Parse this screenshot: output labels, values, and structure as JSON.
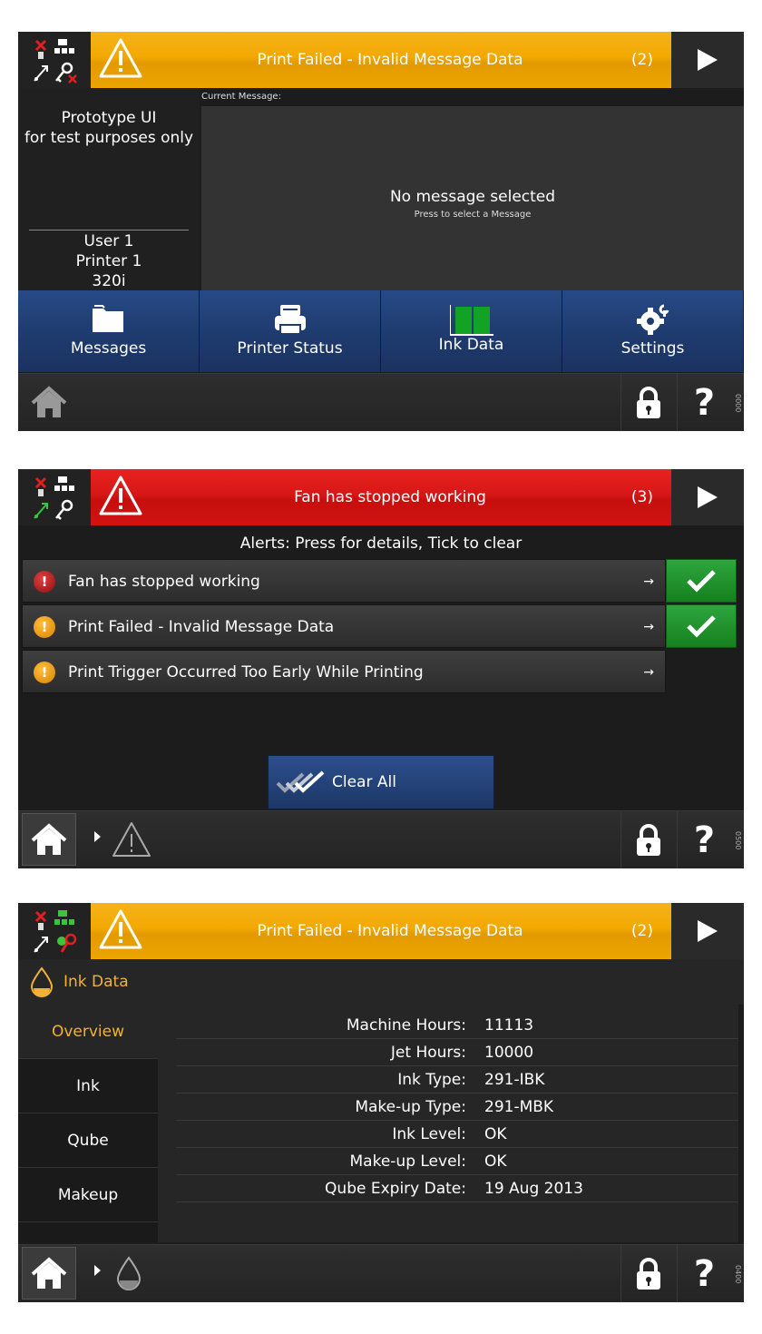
{
  "colors": {
    "amber": "#f2a900",
    "red": "#d71716",
    "nav_blue": "#1f3c70",
    "accent_orange": "#f2b233",
    "green": "#1f9a2e"
  },
  "screen1": {
    "banner": {
      "text": "Print Failed - Invalid Message Data",
      "count": "(2)"
    },
    "left_panel": {
      "line1": "Prototype UI",
      "line2": "for test purposes only",
      "user": "User 1",
      "printer": "Printer 1",
      "model": "320i"
    },
    "current_message_label": "Current Message:",
    "no_message": "No message selected",
    "no_message_hint": "Press to select a Message",
    "nav": [
      {
        "label": "Messages",
        "icon": "folder-icon"
      },
      {
        "label": "Printer Status",
        "icon": "printer-icon"
      },
      {
        "label": "Ink Data",
        "icon": "ink-level-icon"
      },
      {
        "label": "Settings",
        "icon": "settings-gear-icon"
      }
    ],
    "screen_code": "0000"
  },
  "screen2": {
    "banner": {
      "text": "Fan has stopped working",
      "count": "(3)"
    },
    "header": "Alerts: Press for details, Tick to clear",
    "alerts": [
      {
        "text": "Fan has stopped working",
        "severity": "error",
        "arrow": "→"
      },
      {
        "text": "Print Failed - Invalid Message Data",
        "severity": "warning",
        "arrow": "→"
      },
      {
        "text": "Print Trigger Occurred Too Early While Printing",
        "severity": "warning",
        "arrow": "→"
      }
    ],
    "clear_all": "Clear All",
    "screen_code": "0500"
  },
  "screen3": {
    "banner": {
      "text": "Print Failed - Invalid Message Data",
      "count": "(2)"
    },
    "title": "Ink Data",
    "tabs": [
      "Overview",
      "Ink",
      "Qube",
      "Makeup"
    ],
    "rows": [
      {
        "label": "Machine Hours:",
        "value": "11113"
      },
      {
        "label": "Jet Hours:",
        "value": "10000"
      },
      {
        "label": "Ink Type:",
        "value": "291-IBK"
      },
      {
        "label": "Make-up Type:",
        "value": "291-MBK"
      },
      {
        "label": "Ink Level:",
        "value": "OK"
      },
      {
        "label": "Make-up Level:",
        "value": "OK"
      },
      {
        "label": "Qube Expiry Date:",
        "value": "19 Aug 2013"
      }
    ],
    "screen_code": "0400"
  },
  "icons": {
    "warning": "warning-triangle-icon",
    "next": "play-arrow-icon",
    "home": "home-icon",
    "lock": "padlock-icon",
    "help": "?"
  }
}
